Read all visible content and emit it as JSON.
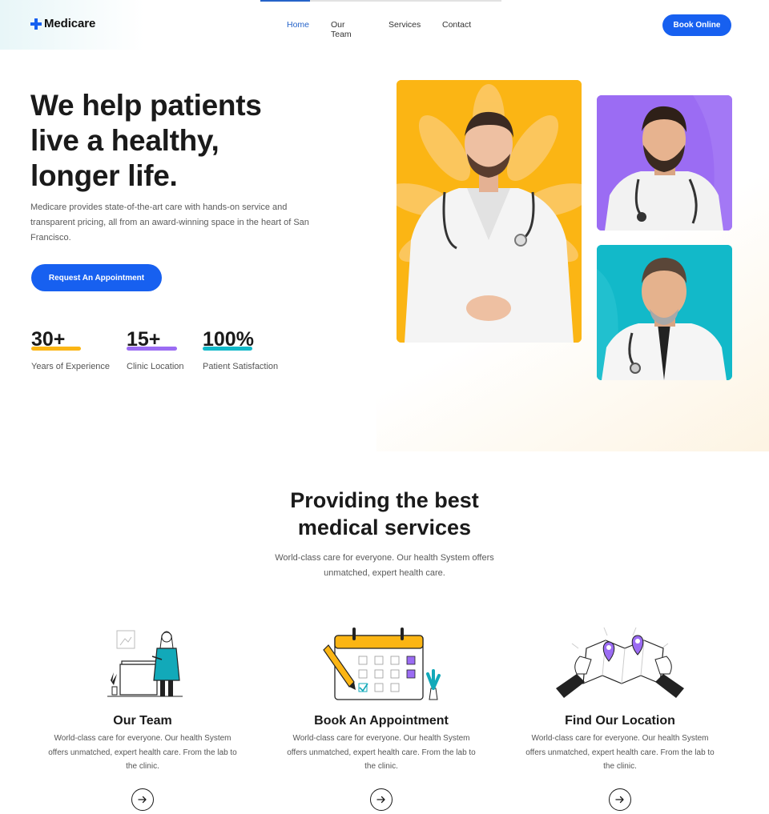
{
  "brand": {
    "name": "Medicare"
  },
  "nav": {
    "items": [
      {
        "label": "Home",
        "active": true
      },
      {
        "label": "Our Team"
      },
      {
        "label": "Services"
      },
      {
        "label": "Contact"
      }
    ],
    "cta_label": "Book Online"
  },
  "hero": {
    "title_lines": [
      "We help patients",
      "live a healthy,",
      "longer life."
    ],
    "description": "Medicare provides state-of-the-art care with hands-on service and transparent pricing, all from an award-winning space in the heart of San Francisco.",
    "cta_label": "Request An Appointment",
    "stats": [
      {
        "value": "30+",
        "label": "Years of Experience",
        "accent": "#fbb514"
      },
      {
        "value": "15+",
        "label": "Clinic Location",
        "accent": "#9b6cf3"
      },
      {
        "value": "100%",
        "label": "Patient Satisfaction",
        "accent": "#12b9c9"
      }
    ],
    "photo_colors": {
      "main": "#fbb514",
      "top": "#9b6cf3",
      "bottom": "#12b9c9"
    }
  },
  "services": {
    "title_lines": [
      "Providing the best",
      "medical services"
    ],
    "subtitle": "World-class care for everyone. Our health System offers unmatched, expert health care.",
    "cards": [
      {
        "title": "Our Team",
        "description": "World-class care for everyone. Our health System offers unmatched, expert health care. From the lab to the clinic.",
        "icon": "doctor-illustration"
      },
      {
        "title": "Book An Appointment",
        "description": "World-class care for everyone. Our health System offers unmatched, expert health care. From the lab to the clinic.",
        "icon": "calendar-illustration"
      },
      {
        "title": "Find Our Location",
        "description": "World-class care for everyone. Our health System offers unmatched, expert health care. From the lab to the clinic.",
        "icon": "map-illustration"
      }
    ]
  },
  "colors": {
    "primary": "#1760f0",
    "nav_active": "#2563c9",
    "text": "#1a1a1a"
  }
}
